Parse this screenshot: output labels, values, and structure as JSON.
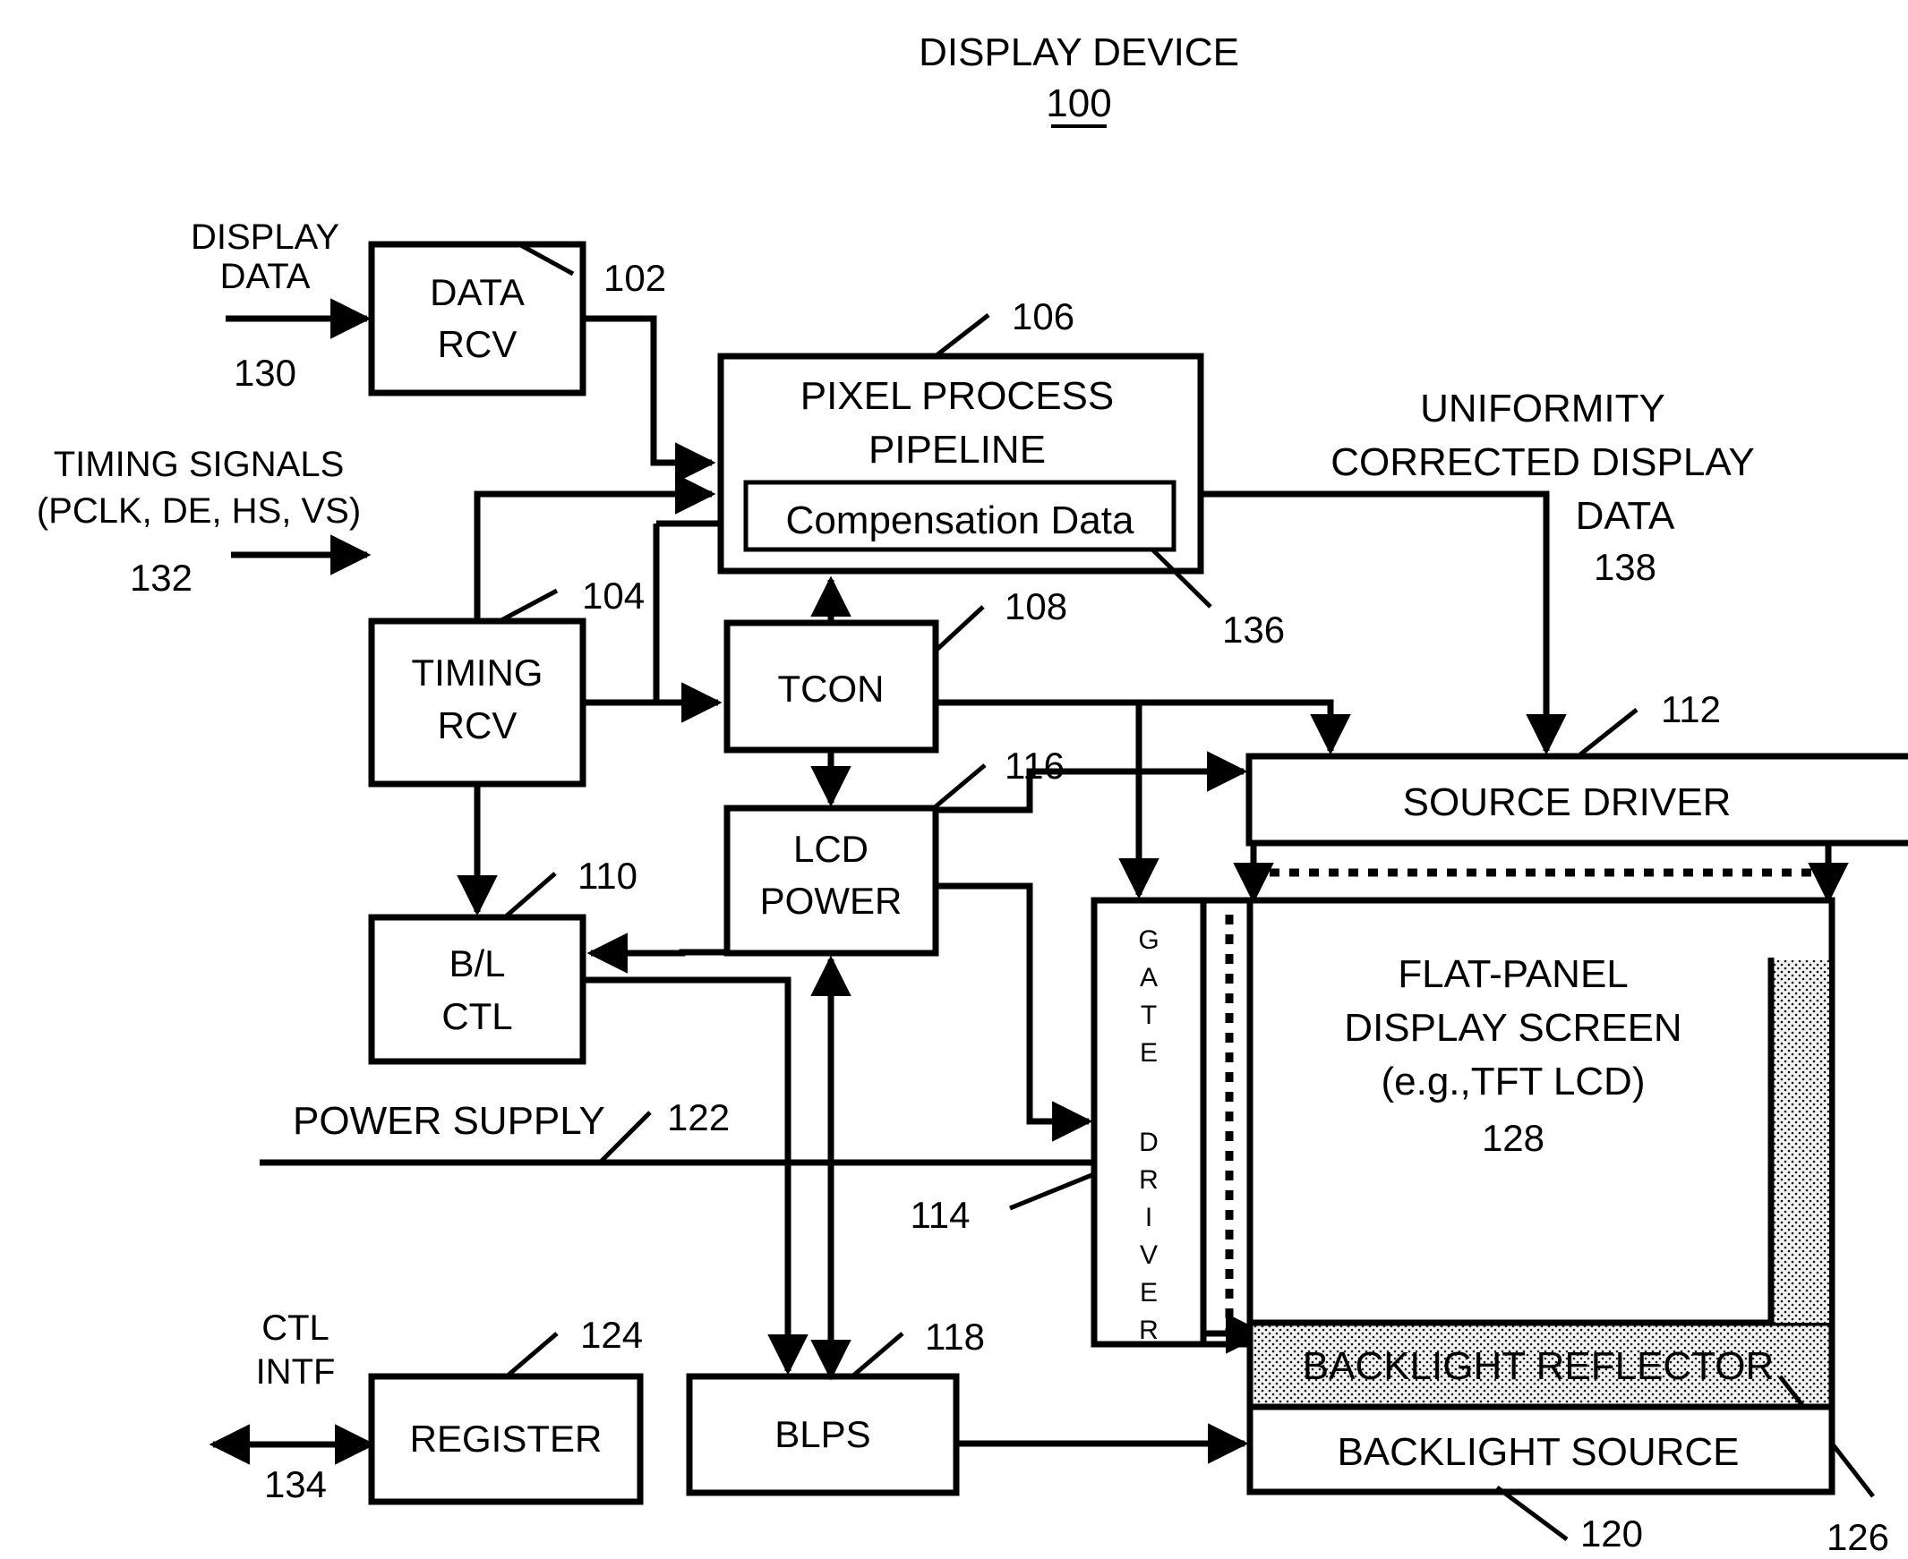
{
  "title": {
    "main": "DISPLAY DEVICE",
    "ref": "100"
  },
  "inputs": {
    "display_data": {
      "line1": "DISPLAY",
      "line2": "DATA",
      "ref": "130"
    },
    "timing_signals": {
      "line1": "TIMING SIGNALS",
      "line2": "(PCLK,  DE, HS, VS)",
      "ref": "132"
    },
    "ctl_intf": {
      "line1": "CTL",
      "line2": "INTF",
      "ref": "134"
    }
  },
  "blocks": {
    "data_rcv": {
      "line1": "DATA",
      "line2": "RCV",
      "ref": "102"
    },
    "timing_rcv": {
      "line1": "TIMING",
      "line2": "RCV",
      "ref": "104"
    },
    "pixel_pipeline": {
      "line1": "PIXEL PROCESS",
      "line2": "PIPELINE",
      "ref": "106"
    },
    "compensation_data": {
      "label": "Compensation Data",
      "ref": "136"
    },
    "tcon": {
      "label": "TCON",
      "ref": "108"
    },
    "lcd_power": {
      "line1": "LCD",
      "line2": "POWER",
      "ref": "116"
    },
    "bl_ctl": {
      "line1": "B/L",
      "line2": "CTL",
      "ref": "110"
    },
    "register": {
      "label": "REGISTER",
      "ref": "124"
    },
    "blps": {
      "label": "BLPS",
      "ref": "118"
    },
    "source_driver": {
      "label": "SOURCE DRIVER",
      "ref": "112"
    },
    "gate_driver": {
      "label": "GATE DRIVER",
      "ref": "114"
    },
    "panel": {
      "line1": "FLAT-PANEL",
      "line2": "DISPLAY SCREEN",
      "line3": "(e.g.,TFT LCD)",
      "ref": "128"
    },
    "backlight_reflector": {
      "label": "BACKLIGHT REFLECTOR",
      "ref": "126"
    },
    "backlight_source": {
      "label": "BACKLIGHT SOURCE",
      "ref": "120"
    }
  },
  "annotations": {
    "power_supply": {
      "label": "POWER SUPPLY",
      "ref": "122"
    },
    "uniformity_data": {
      "line1": "UNIFORMITY",
      "line2": "CORRECTED DISPLAY",
      "line3": "DATA",
      "ref": "138"
    }
  },
  "colors": {
    "stroke": "#000000",
    "background": "#ffffff",
    "reflector_fill": "#e8e8e8"
  }
}
